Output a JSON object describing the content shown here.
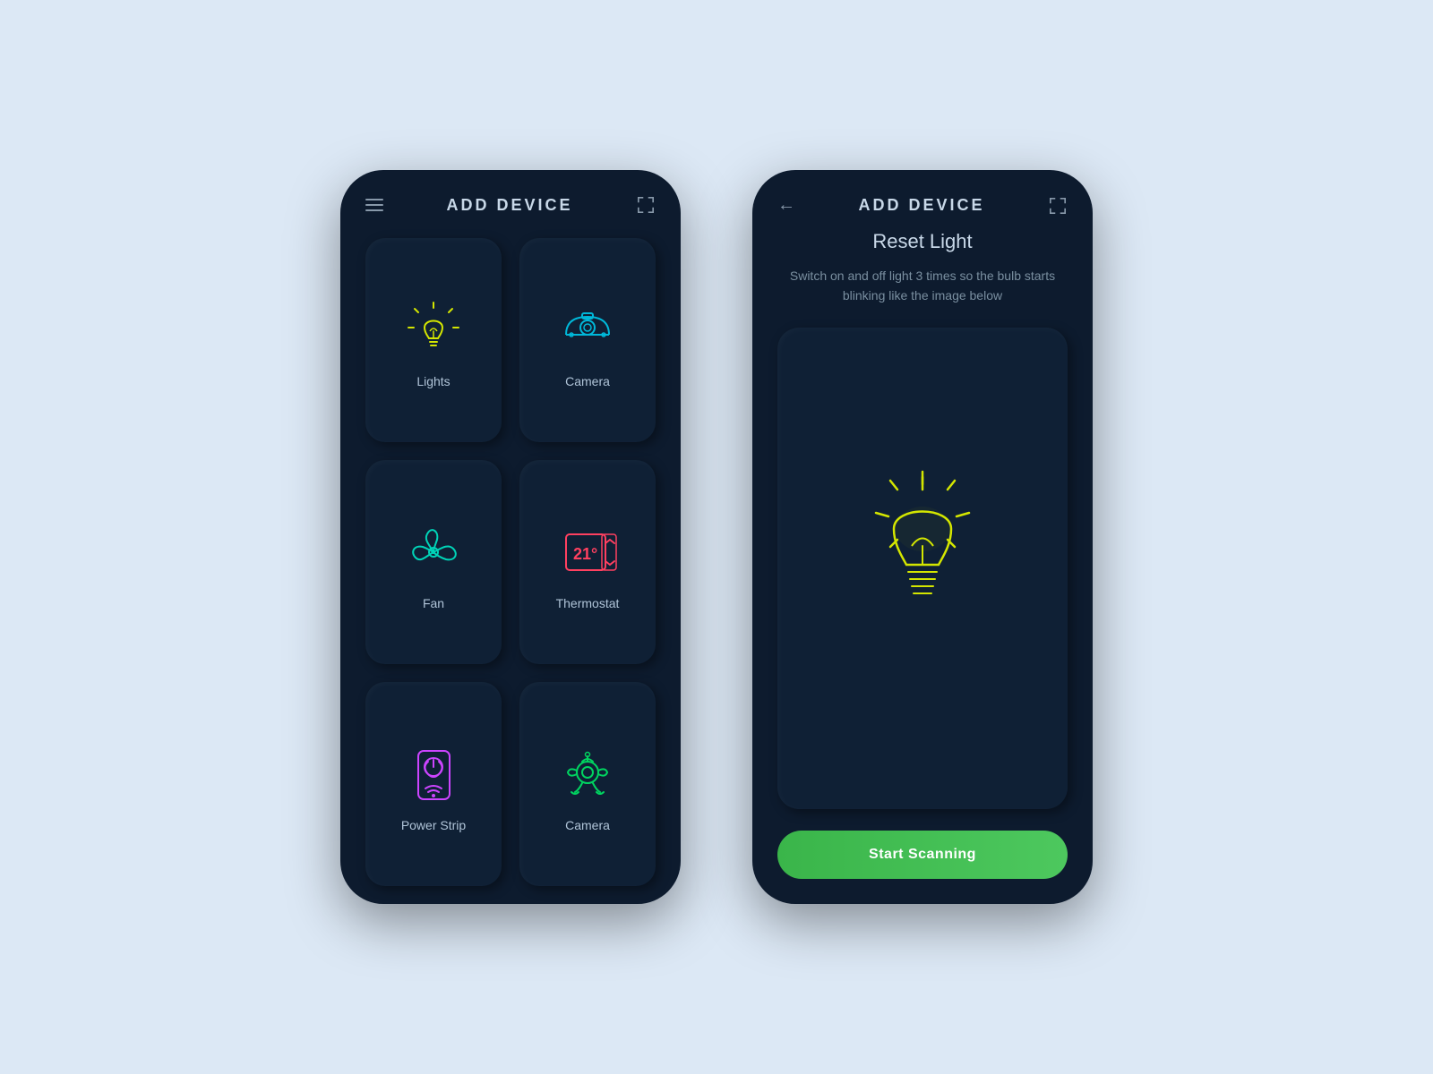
{
  "left_phone": {
    "title": "ADD DEVICE",
    "devices": [
      {
        "id": "lights",
        "label": "Lights",
        "color": "#d4e600",
        "icon": "lightbulb"
      },
      {
        "id": "camera",
        "label": "Camera",
        "color": "#00b8d9",
        "icon": "camera"
      },
      {
        "id": "fan",
        "label": "Fan",
        "color": "#00d4b8",
        "icon": "fan"
      },
      {
        "id": "thermostat",
        "label": "Thermostat",
        "color": "#ff4060",
        "icon": "thermostat",
        "temp": "21°"
      },
      {
        "id": "power-strip",
        "label": "Power Strip",
        "color": "#cc44ff",
        "icon": "powerstrip"
      },
      {
        "id": "camera2",
        "label": "Camera",
        "color": "#00d460",
        "icon": "camera2"
      }
    ]
  },
  "right_phone": {
    "title": "ADD DEVICE",
    "back_label": "←",
    "reset_title": "Reset Light",
    "reset_desc": "Switch on and off light 3 times so the bulb starts blinking like the image below",
    "scan_button": "Start Scanning"
  }
}
